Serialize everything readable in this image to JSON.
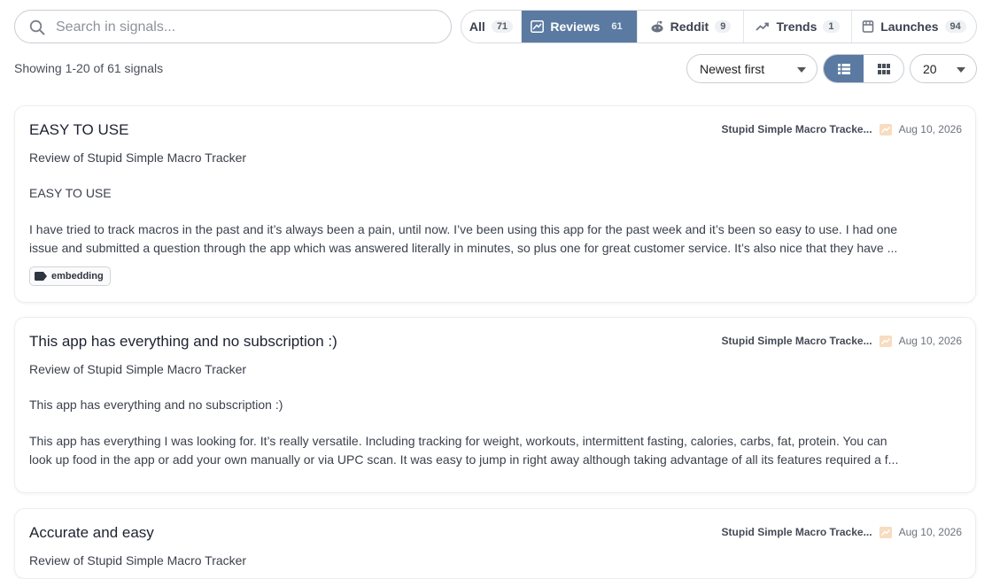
{
  "search": {
    "placeholder": "Search in signals...",
    "value": ""
  },
  "tabs": [
    {
      "label": "All",
      "count": "71",
      "icon": "none"
    },
    {
      "label": "Reviews",
      "count": "61",
      "icon": "review-icon"
    },
    {
      "label": "Reddit",
      "count": "9",
      "icon": "reddit-icon"
    },
    {
      "label": "Trends",
      "count": "1",
      "icon": "trend-icon"
    },
    {
      "label": "Launches",
      "count": "94",
      "icon": "store-icon"
    }
  ],
  "showing": "Showing 1-20 of 61 signals",
  "sort": {
    "selected": "Newest first"
  },
  "per_page": {
    "selected": "20"
  },
  "colors": {
    "accent": "#5b7aa1",
    "review_badge": "#f3c99c"
  },
  "cards": [
    {
      "title": "EASY TO USE",
      "app": "Stupid Simple Macro Tracke...",
      "date": "Aug 10, 2026",
      "subtitle": "Review of Stupid Simple Macro Tracker",
      "heading": "EASY TO USE",
      "body_line1": "I have tried to track macros in the past and it’s always been a pain, until now. I’ve been using this app for the past week and it’s been so easy to use. I had one",
      "body_line2": "issue and submitted a question through the app which was answered literally in minutes, so plus one for great customer service. It’s also nice that they have ...",
      "tag": "embedding"
    },
    {
      "title": "This app has everything and no subscription :)",
      "app": "Stupid Simple Macro Tracke...",
      "date": "Aug 10, 2026",
      "subtitle": "Review of Stupid Simple Macro Tracker",
      "heading": "This app has everything and no subscription :)",
      "body_line1": "This app has everything I was looking for. It’s really versatile. Including tracking for weight, workouts, intermittent fasting, calories, carbs, fat, protein. You can",
      "body_line2": "look up food in the app or add your own manually or via UPC scan. It was easy to jump in right away although taking advantage of all its features required a f..."
    },
    {
      "title": "Accurate and easy",
      "app": "Stupid Simple Macro Tracke...",
      "date": "Aug 10, 2026",
      "subtitle": "Review of Stupid Simple Macro Tracker"
    }
  ]
}
